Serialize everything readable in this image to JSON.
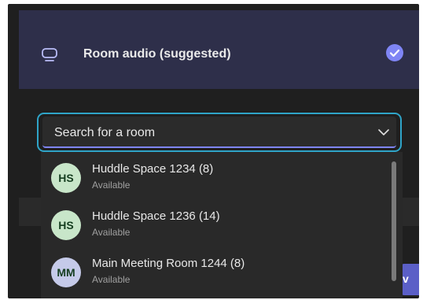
{
  "room_audio": {
    "label": "Room audio (suggested)",
    "icon": "monitor-icon",
    "selected": true,
    "check_icon": "check-circle-icon"
  },
  "search": {
    "text": "Search for a room",
    "chevron_icon": "chevron-down-icon"
  },
  "rooms": [
    {
      "initials": "HS",
      "name": "Huddle Space 1234 (8)",
      "status": "Available",
      "avatar_color": "#c8e6c9"
    },
    {
      "initials": "HS",
      "name": "Huddle Space 1236 (14)",
      "status": "Available",
      "avatar_color": "#c8e6c9"
    },
    {
      "initials": "MM",
      "name": "Main Meeting Room 1244 (8)",
      "status": "Available",
      "avatar_color": "#c5cae9"
    }
  ],
  "background_button": {
    "label": "v"
  },
  "colors": {
    "accent": "#5b5fc7",
    "focus_border": "#2fa4c8",
    "panel": "#2e2f4a"
  }
}
